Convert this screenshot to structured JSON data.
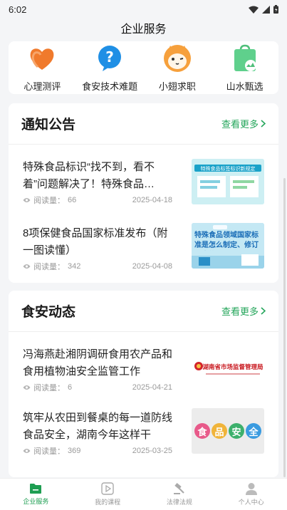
{
  "status_bar": {
    "time": "6:02"
  },
  "header": {
    "title": "企业服务"
  },
  "quick_links": [
    {
      "label": "心理测评",
      "icon": "heart-icon"
    },
    {
      "label": "食安技术难题",
      "icon": "question-icon"
    },
    {
      "label": "小翅求职",
      "icon": "mascot-icon"
    },
    {
      "label": "山水甄选",
      "icon": "shopping-bag-icon"
    }
  ],
  "notice": {
    "title": "通知公告",
    "more": "查看更多",
    "items": [
      {
        "title": "特殊食品标识“找不到，看不着”问题解决了！特殊食品…",
        "reads_label": "阅读量：",
        "reads": "66",
        "date": "2025-04-18",
        "thumb_text": "特殊食品标签标识新规定"
      },
      {
        "title": "8项保健食品国家标准发布（附一图读懂）",
        "reads_label": "阅读量：",
        "reads": "342",
        "date": "2025-04-08",
        "thumb_text": "特殊食品领域国家标准是怎么制定、修订出来的"
      }
    ]
  },
  "news": {
    "title": "食安动态",
    "more": "查看更多",
    "items": [
      {
        "title": "冯海燕赴湘阴调研食用农产品和食用植物油安全监管工作",
        "reads_label": "阅读量：",
        "reads": "6",
        "date": "2025-04-21",
        "thumb_text": "湖南省市场监督管理局"
      },
      {
        "title": "筑牢从农田到餐桌的每一道防线 食品安全，湖南今年这样干",
        "reads_label": "阅读量：",
        "reads": "369",
        "date": "2025-03-25",
        "thumb_text": "食品安全"
      }
    ]
  },
  "bottom_nav": [
    {
      "label": "企业服务",
      "active": true
    },
    {
      "label": "我的课程",
      "active": false
    },
    {
      "label": "法律法规",
      "active": false
    },
    {
      "label": "个人中心",
      "active": false
    }
  ],
  "colors": {
    "accent": "#1e9e52",
    "link": "#23a55a"
  }
}
